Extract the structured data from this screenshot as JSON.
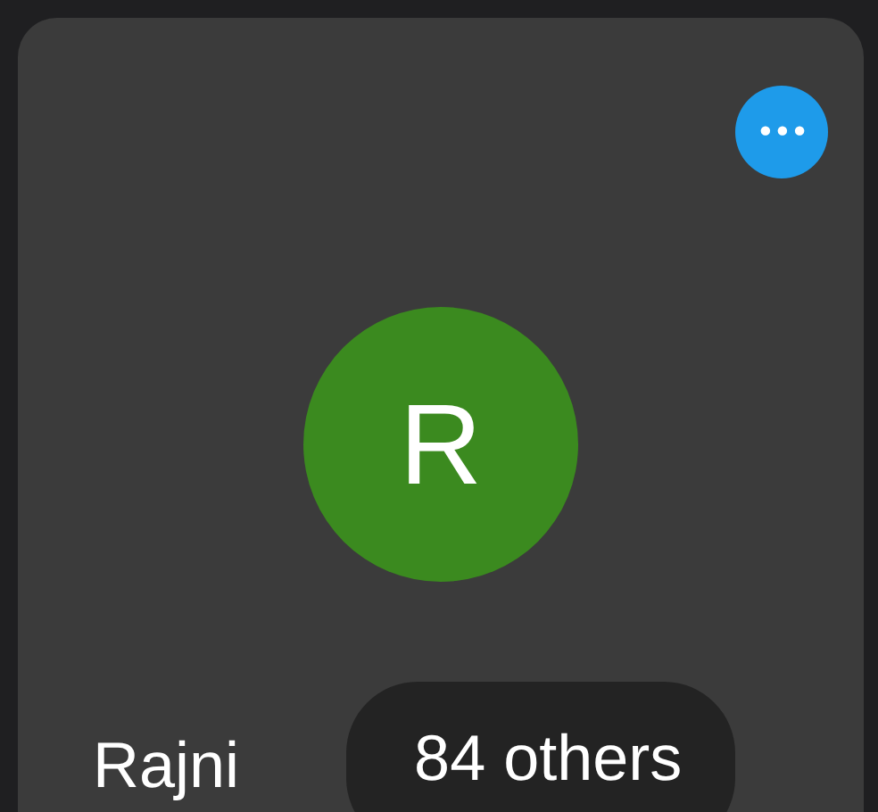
{
  "tile": {
    "avatar_letter": "R",
    "name": "Rajni",
    "others_label": "84 others",
    "more_button": "•••"
  }
}
